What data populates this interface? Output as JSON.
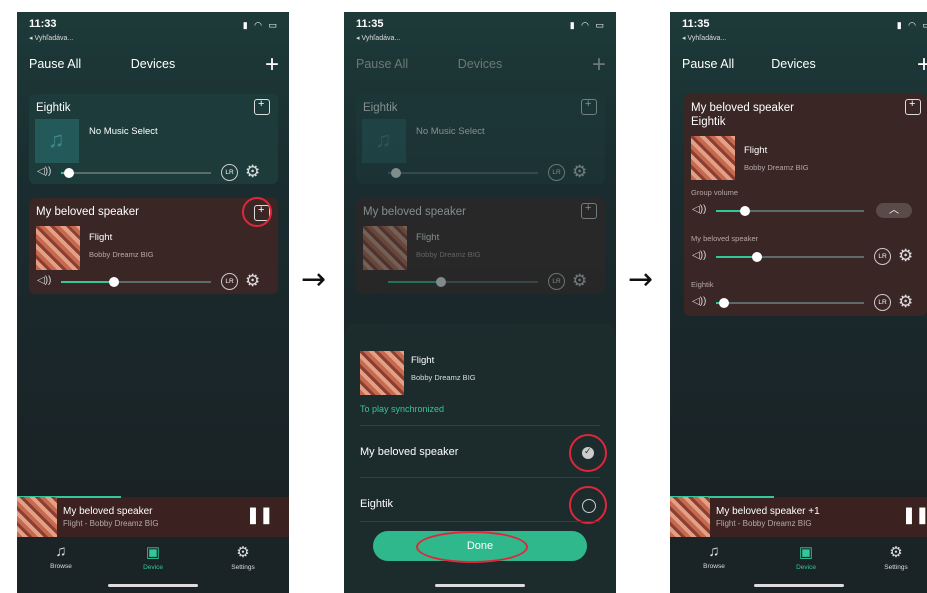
{
  "screen1": {
    "time": "11:33",
    "back": "◂ Vyhľadáva...",
    "nav": {
      "pause_all": "Pause All",
      "title": "Devices"
    },
    "cards": [
      {
        "name": "Eightik",
        "track": "No Music Select",
        "artist": "",
        "volume": 0.05
      },
      {
        "name": "My beloved speaker",
        "track": "Flight",
        "artist": "Bobby Dreamz BIG",
        "volume": 0.35
      }
    ],
    "lr_label": "LR",
    "mini": {
      "title": "My beloved speaker",
      "subtitle": "Flight - Bobby Dreamz BIG"
    },
    "tabs": [
      "Browse",
      "Device",
      "Settings"
    ]
  },
  "screen2": {
    "time": "11:35",
    "back": "◂ Vyhľadáva...",
    "nav": {
      "pause_all": "Pause All",
      "title": "Devices"
    },
    "cards": [
      {
        "name": "Eightik",
        "track": "No Music Select"
      },
      {
        "name": "My beloved speaker",
        "track": "Flight",
        "artist": "Bobby Dreamz BIG"
      }
    ],
    "sheet": {
      "track": "Flight",
      "artist": "Bobby Dreamz BIG",
      "sync_label": "To play synchronized",
      "options": [
        {
          "label": "My beloved speaker",
          "checked": true
        },
        {
          "label": "Eightik",
          "checked": false
        }
      ],
      "done": "Done"
    }
  },
  "screen3": {
    "time": "11:35",
    "back": "◂ Vyhľadáva...",
    "nav": {
      "pause_all": "Pause All",
      "title": "Devices"
    },
    "group": {
      "title1": "My beloved speaker",
      "title2": "Eightik",
      "track": "Flight",
      "artist": "Bobby Dreamz BIG",
      "group_volume_label": "Group volume",
      "speakers": [
        {
          "label": "My beloved speaker",
          "volume": 0.3
        },
        {
          "label": "Eightik",
          "volume": 0.05
        }
      ],
      "group_volume": 0.2
    },
    "mini": {
      "title": "My beloved speaker +1",
      "subtitle": "Flight - Bobby Dreamz BIG"
    },
    "tabs": [
      "Browse",
      "Device",
      "Settings"
    ]
  },
  "arrows": [
    "→",
    "→"
  ],
  "colors": {
    "accent": "#34c79a",
    "highlight": "#e0263a",
    "card_teal": "#1e3b3c",
    "card_brown": "#3a2625"
  }
}
